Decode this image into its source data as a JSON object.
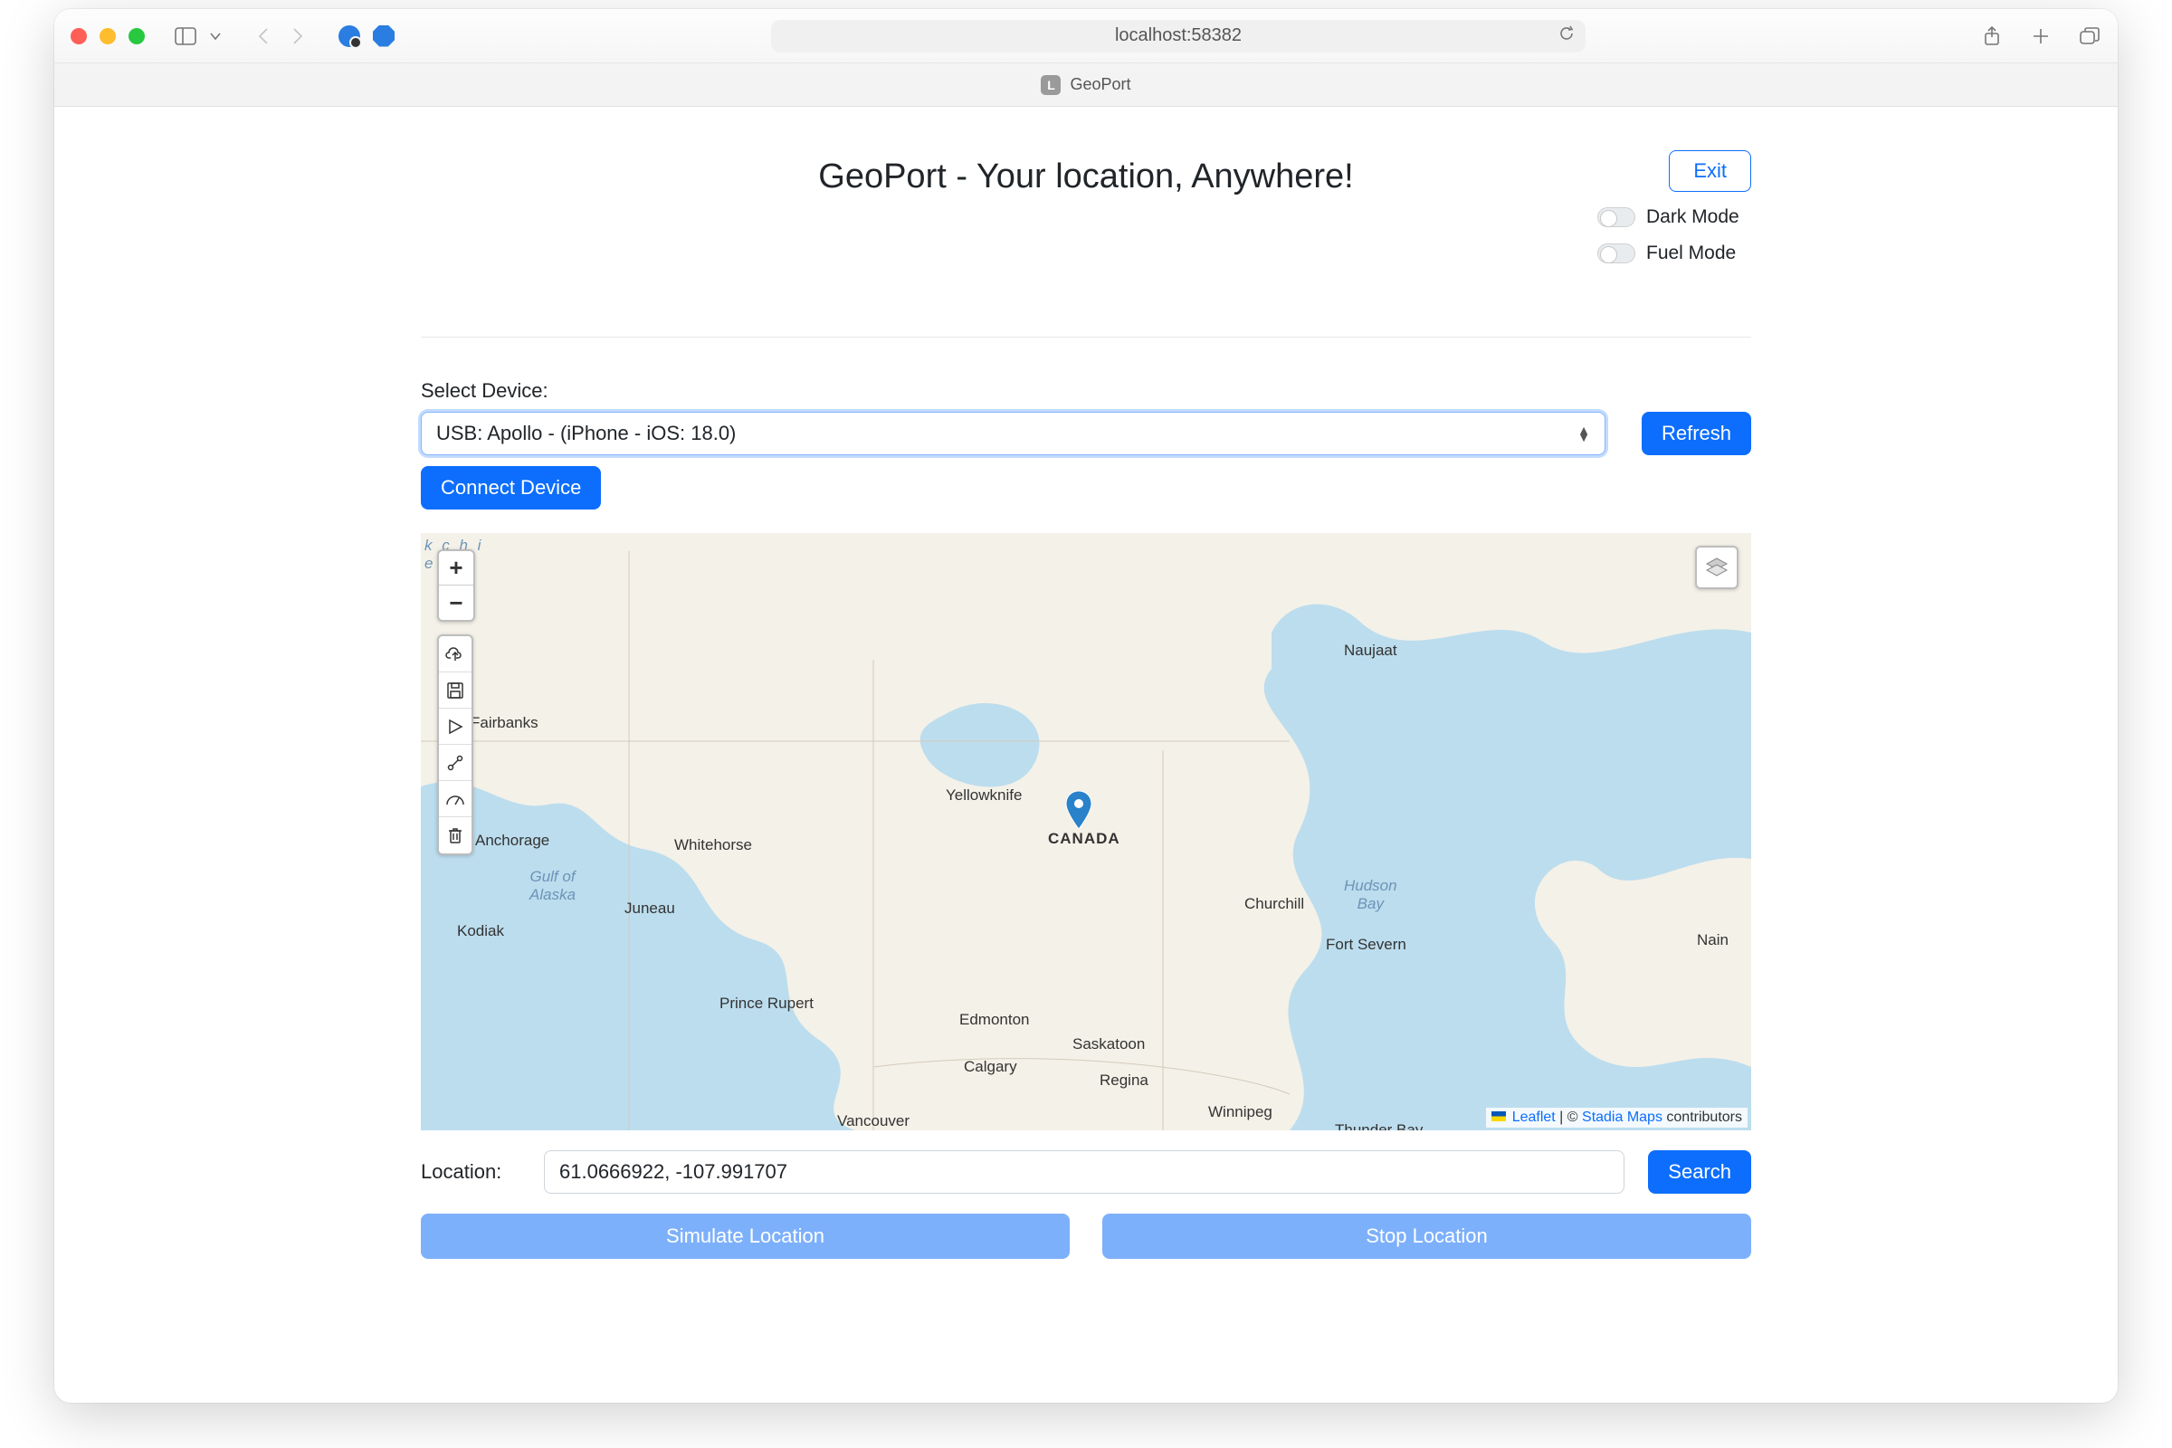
{
  "browser": {
    "address": "localhost:58382",
    "tab_icon_letter": "L",
    "tab_title": "GeoPort"
  },
  "header": {
    "title": "GeoPort - Your location, Anywhere!",
    "exit_label": "Exit",
    "dark_mode_label": "Dark Mode",
    "fuel_mode_label": "Fuel Mode",
    "dark_mode_on": false,
    "fuel_mode_on": false
  },
  "device": {
    "select_label": "Select Device:",
    "selected": "USB: Apollo - (iPhone - iOS: 18.0)",
    "refresh_label": "Refresh",
    "connect_label": "Connect Device"
  },
  "map": {
    "zoom_in": "+",
    "zoom_out": "−",
    "attribution_leaflet": "Leaflet",
    "attribution_sep": " | © ",
    "attribution_provider": "Stadia Maps",
    "attribution_tail": " contributors",
    "labels": {
      "fairbanks": "Fairbanks",
      "anchorage": "Anchorage",
      "juneau": "Juneau",
      "kodiak": "Kodiak",
      "gulf": "Gulf of\nAlaska",
      "whitehorse": "Whitehorse",
      "prince_rupert": "Prince Rupert",
      "yellowknife": "Yellowknife",
      "canada": "CANADA",
      "naujaat": "Naujaat",
      "churchill": "Churchill",
      "fort_severn": "Fort Severn",
      "nain": "Nain",
      "hudson": "Hudson\nBay",
      "edmonton": "Edmonton",
      "calgary": "Calgary",
      "vancouver": "Vancouver",
      "saskatoon": "Saskatoon",
      "regina": "Regina",
      "winnipeg": "Winnipeg",
      "thunder": "Thunder Bay",
      "kchi": "k c h i",
      "e": "e"
    }
  },
  "location": {
    "label": "Location:",
    "value": "61.0666922, -107.991707",
    "search_label": "Search"
  },
  "actions": {
    "simulate": "Simulate Location",
    "stop": "Stop Location"
  }
}
